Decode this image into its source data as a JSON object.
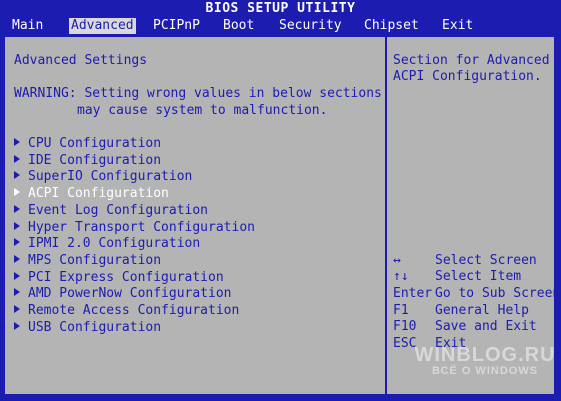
{
  "title": "BIOS SETUP UTILITY",
  "menu": [
    "Main",
    "Advanced",
    "PCIPnP",
    "Boot",
    "Security",
    "Chipset",
    "Exit"
  ],
  "active_menu": "Advanced",
  "section_title": "Advanced Settings",
  "warning_line1": "WARNING: Setting wrong values in below sections",
  "warning_line2": "may cause system to malfunction.",
  "items": [
    "CPU Configuration",
    "IDE Configuration",
    "SuperIO Configuration",
    "ACPI Configuration",
    "Event Log Configuration",
    "Hyper Transport Configuration",
    "IPMI 2.0 Configuration",
    "MPS Configuration",
    "PCI Express Configuration",
    "AMD PowerNow Configuration",
    "Remote Access Configuration",
    "USB Configuration"
  ],
  "selected_item": "ACPI Configuration",
  "help_line1": "Section for Advanced",
  "help_line2": "ACPI Configuration.",
  "keys": [
    {
      "key": "↔",
      "action": "Select Screen"
    },
    {
      "key": "↑↓",
      "action": "Select Item"
    },
    {
      "key": "Enter",
      "action": "Go to Sub Screen"
    },
    {
      "key": "F1",
      "action": "General Help"
    },
    {
      "key": "F10",
      "action": "Save and Exit"
    },
    {
      "key": "ESC",
      "action": "Exit"
    }
  ],
  "watermark_line1": "WINBLOG.RU",
  "watermark_line2": "ВСЁ О WINDOWS",
  "colors": {
    "background": "#1c1cb0",
    "panel": "#b4b4b4",
    "text": "#1c1cb0",
    "highlight_text": "#ffffff"
  }
}
